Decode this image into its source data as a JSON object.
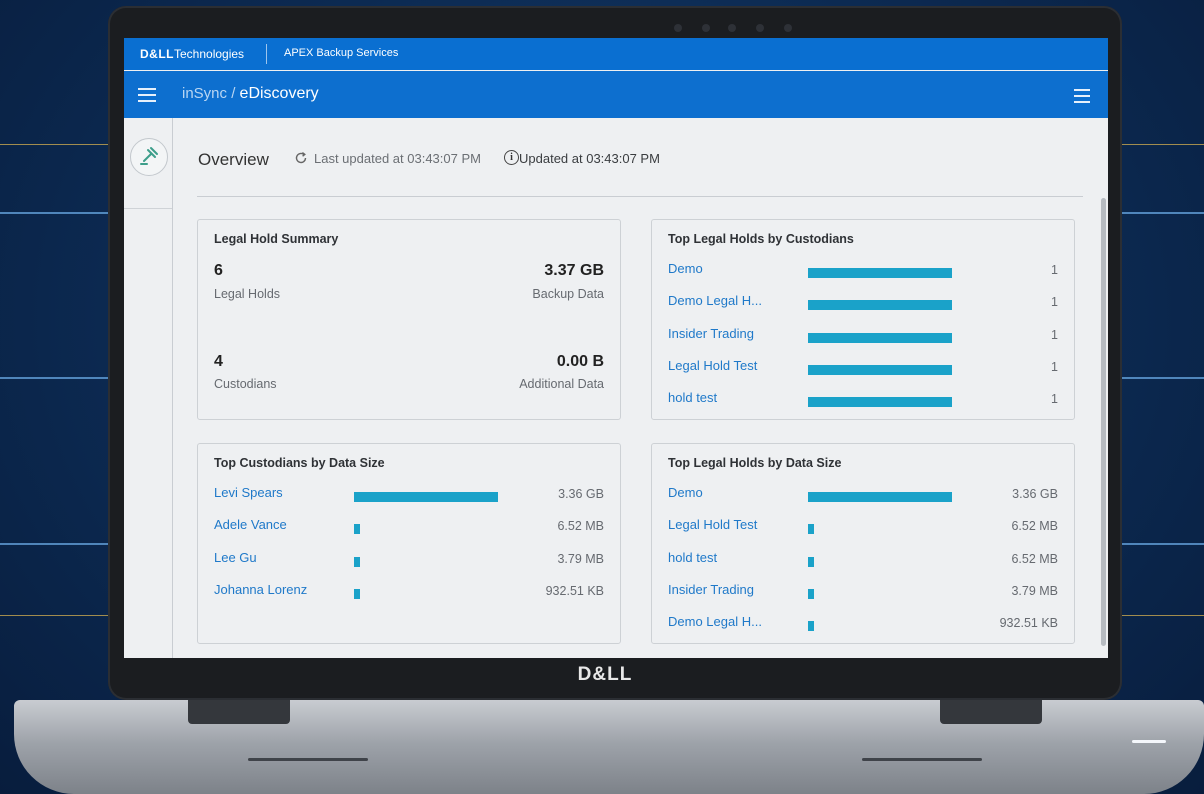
{
  "topbar": {
    "brand_bold": "D&LL",
    "brand_rest": "Technologies",
    "product": "APEX Backup Services"
  },
  "breadcrumb": {
    "parent": "inSync",
    "separator": "/",
    "current": "eDiscovery"
  },
  "overview": {
    "title": "Overview",
    "last_updated": "Last updated at 03:43:07 PM",
    "updated": "Updated at 03:43:07 PM"
  },
  "legal_hold_summary": {
    "title": "Legal Hold Summary",
    "legal_holds_value": "6",
    "legal_holds_label": "Legal Holds",
    "backup_data_value": "3.37 GB",
    "backup_data_label": "Backup Data",
    "custodians_value": "4",
    "custodians_label": "Custodians",
    "additional_data_value": "0.00 B",
    "additional_data_label": "Additional Data"
  },
  "top_holds_by_custodians": {
    "title": "Top Legal Holds by Custodians",
    "max": 1,
    "rows": [
      {
        "label": "Demo",
        "value": "1",
        "amount": 1
      },
      {
        "label": "Demo Legal H...",
        "value": "1",
        "amount": 1
      },
      {
        "label": "Insider Trading",
        "value": "1",
        "amount": 1
      },
      {
        "label": "Legal Hold Test",
        "value": "1",
        "amount": 1
      },
      {
        "label": "hold test",
        "value": "1",
        "amount": 1
      }
    ]
  },
  "top_custodians_by_size": {
    "title": "Top Custodians by Data Size",
    "rows": [
      {
        "label": "Levi Spears",
        "value": "3.36 GB",
        "fraction": 1.0
      },
      {
        "label": "Adele Vance",
        "value": "6.52 MB",
        "fraction": 0.002
      },
      {
        "label": "Lee Gu",
        "value": "3.79 MB",
        "fraction": 0.001
      },
      {
        "label": "Johanna Lorenz",
        "value": "932.51 KB",
        "fraction": 0.0003
      }
    ]
  },
  "top_holds_by_size": {
    "title": "Top Legal Holds by Data Size",
    "rows": [
      {
        "label": "Demo",
        "value": "3.36 GB",
        "fraction": 1.0
      },
      {
        "label": "Legal Hold Test",
        "value": "6.52 MB",
        "fraction": 0.002
      },
      {
        "label": "hold test",
        "value": "6.52 MB",
        "fraction": 0.002
      },
      {
        "label": "Insider Trading",
        "value": "3.79 MB",
        "fraction": 0.001
      },
      {
        "label": "Demo Legal H...",
        "value": "932.51 KB",
        "fraction": 0.0003
      }
    ]
  },
  "bezel_logo": "D&LL",
  "colors": {
    "header": "#0a6fd1",
    "bar": "#1aa2c9",
    "link": "#1f79c9"
  }
}
